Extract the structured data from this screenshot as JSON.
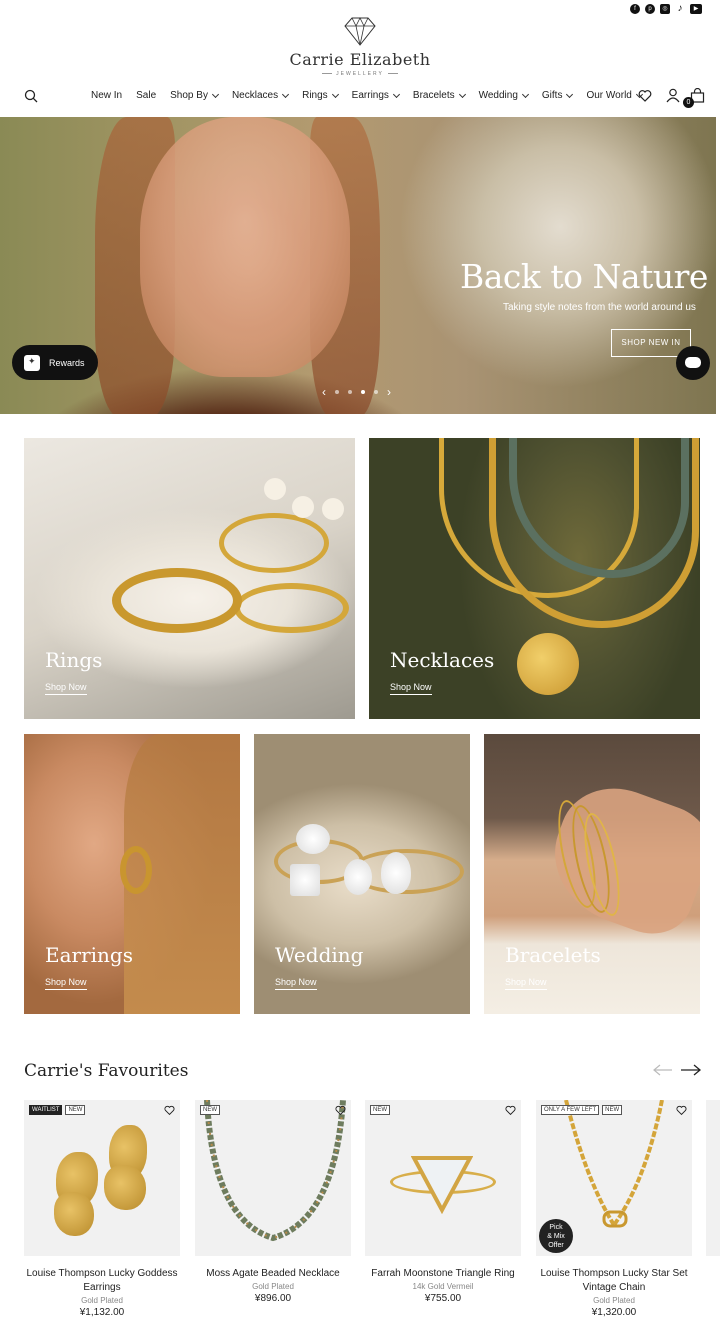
{
  "header": {
    "social_icons": [
      "facebook-icon",
      "pinterest-icon",
      "instagram-icon",
      "tiktok-icon",
      "youtube-icon"
    ],
    "brand_name": "Carrie Elizabeth",
    "brand_sub": "JEWELLERY",
    "cart_count": "0"
  },
  "nav": {
    "items": [
      {
        "label": "New In",
        "dropdown": false
      },
      {
        "label": "Sale",
        "dropdown": false
      },
      {
        "label": "Shop By",
        "dropdown": true
      },
      {
        "label": "Necklaces",
        "dropdown": true
      },
      {
        "label": "Rings",
        "dropdown": true
      },
      {
        "label": "Earrings",
        "dropdown": true
      },
      {
        "label": "Bracelets",
        "dropdown": true
      },
      {
        "label": "Wedding",
        "dropdown": true
      },
      {
        "label": "Gifts",
        "dropdown": true
      },
      {
        "label": "Our World",
        "dropdown": true
      }
    ]
  },
  "hero": {
    "title": "Back to Nature",
    "subtitle": "Taking style notes from the world around us",
    "button": "SHOP NEW IN",
    "slide_count": 4,
    "active_slide": 2
  },
  "rewards": {
    "label": "Rewards"
  },
  "categories": [
    {
      "label": "Rings",
      "link": "Shop Now"
    },
    {
      "label": "Necklaces",
      "link": "Shop Now"
    },
    {
      "label": "Earrings",
      "link": "Shop Now"
    },
    {
      "label": "Wedding",
      "link": "Shop Now"
    },
    {
      "label": "Bracelets",
      "link": "Shop Now"
    }
  ],
  "favourites": {
    "title": "Carrie's Favourites",
    "products": [
      {
        "badges": [
          "WAITLIST",
          "NEW"
        ],
        "name": "Louise Thompson Lucky Goddess Earrings",
        "material": "Gold Plated",
        "price": "¥1,132.00"
      },
      {
        "badges": [
          "NEW"
        ],
        "name": "Moss Agate Beaded Necklace",
        "material": "Gold Plated",
        "price": "¥896.00"
      },
      {
        "badges": [
          "NEW"
        ],
        "name": "Farrah Moonstone Triangle Ring",
        "material": "14k Gold Vermeil",
        "price": "¥755.00"
      },
      {
        "badges": [
          "ONLY A FEW LEFT",
          "NEW"
        ],
        "name": "Louise Thompson Lucky Star Set Vintage Chain",
        "material": "Gold Plated",
        "price": "¥1,320.00",
        "tag": "Pick & Mix Offer"
      }
    ]
  }
}
